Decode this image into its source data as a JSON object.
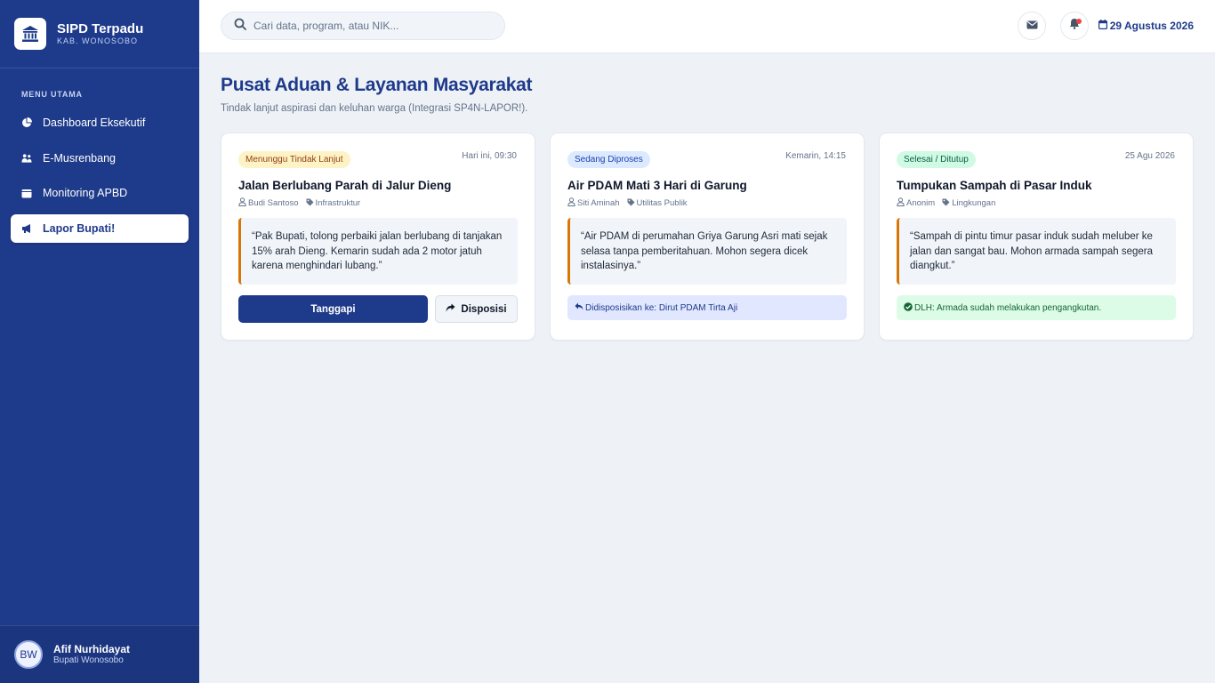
{
  "brand": {
    "title": "SIPD Terpadu",
    "subtitle": "KAB. WONOSOBO"
  },
  "sidebar": {
    "heading": "MENU UTAMA",
    "items": [
      {
        "label": "Dashboard Eksekutif",
        "icon": "pie-chart-icon"
      },
      {
        "label": "E-Musrenbang",
        "icon": "people-icon"
      },
      {
        "label": "Monitoring APBD",
        "icon": "wallet-icon"
      },
      {
        "label": "Lapor Bupati!",
        "icon": "megaphone-icon",
        "active": true
      }
    ]
  },
  "user": {
    "initials": "BW",
    "name": "Afif Nurhidayat",
    "role": "Bupati Wonosobo"
  },
  "header": {
    "search_placeholder": "Cari data, program, atau NIK...",
    "date": "29 Agustus 2026"
  },
  "page": {
    "title": "Pusat Aduan & Layanan Masyarakat",
    "subtitle": "Tindak lanjut aspirasi dan keluhan warga (Integrasi SP4N-LAPOR!)."
  },
  "complaints": [
    {
      "status": "Menunggu Tindak Lanjut",
      "time": "Hari ini, 09:30",
      "title": "Jalan Berlubang Parah di Jalur Dieng",
      "reporter": "Budi Santoso",
      "category": "Infrastruktur",
      "quote": "“Pak Bupati, tolong perbaiki jalan berlubang di tanjakan 15% arah Dieng. Kemarin sudah ada 2 motor jatuh karena menghindari lubang.”",
      "respond_label": "Tanggapi",
      "dispose_label": "Disposisi"
    },
    {
      "status": "Sedang Diproses",
      "time": "Kemarin, 14:15",
      "title": "Air PDAM Mati 3 Hari di Garung",
      "reporter": "Siti Aminah",
      "category": "Utilitas Publik",
      "quote": "“Air PDAM di perumahan Griya Garung Asri mati sejak selasa tanpa pemberitahuan. Mohon segera dicek instalasinya.”",
      "note": "Didisposisikan ke: Dirut PDAM Tirta Aji"
    },
    {
      "status": "Selesai / Ditutup",
      "time": "25 Agu 2026",
      "title": "Tumpukan Sampah di Pasar Induk",
      "reporter": "Anonim",
      "category": "Lingkungan",
      "quote": "“Sampah di pintu timur pasar induk sudah meluber ke jalan dan sangat bau. Mohon armada sampah segera diangkut.”",
      "note": "DLH: Armada sudah melakukan pengangkutan."
    }
  ],
  "colors": {
    "primary": "#1e3a8a",
    "accent_border": "#d97706",
    "notification": "#ef4444"
  }
}
